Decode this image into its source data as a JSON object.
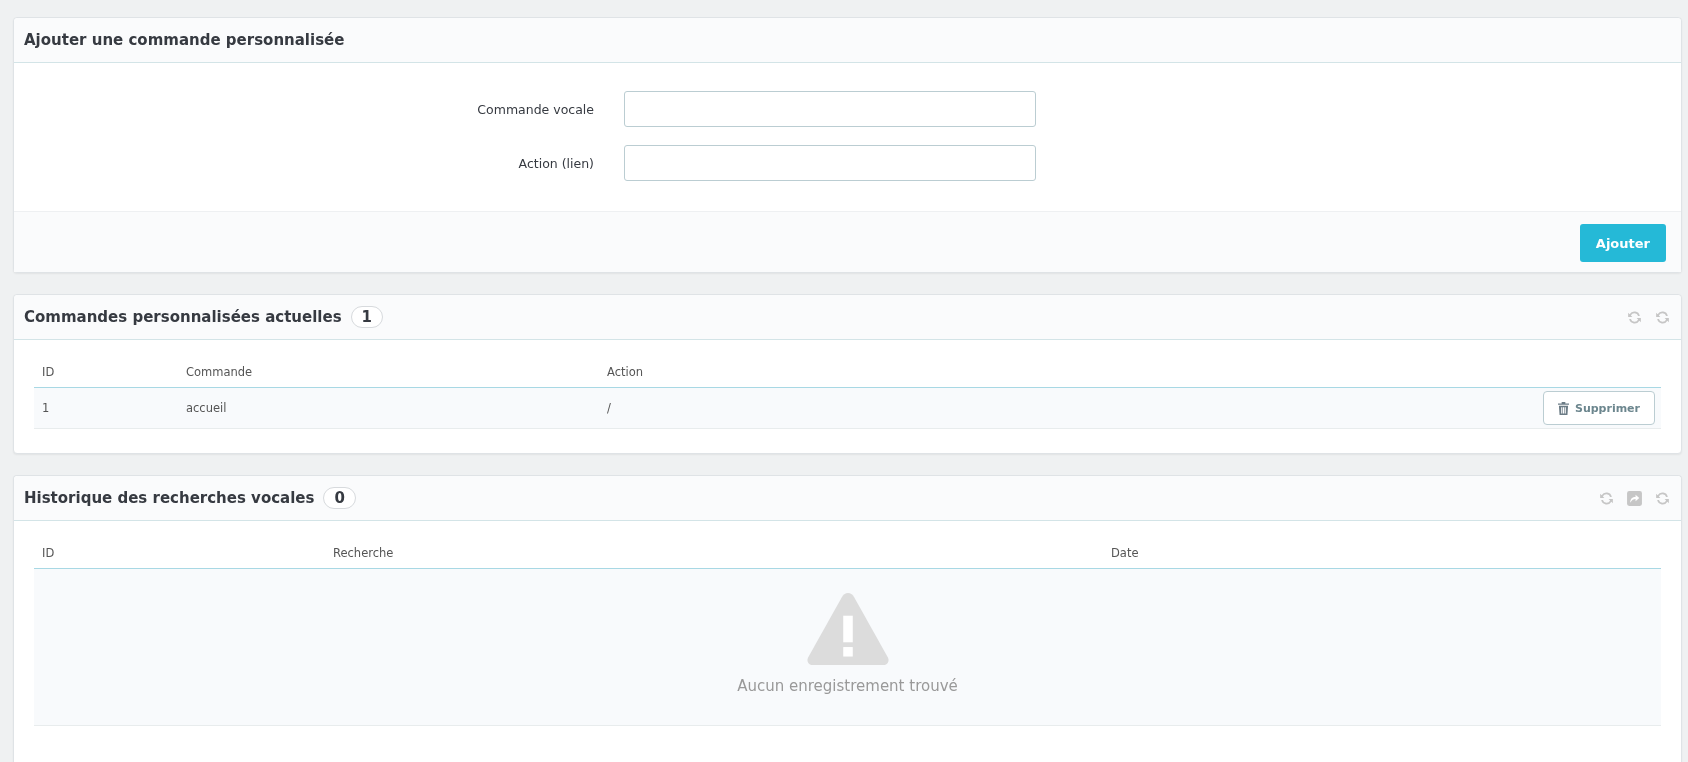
{
  "add_panel": {
    "title": "Ajouter une commande personnalisée",
    "fields": [
      {
        "label": "Commande vocale"
      },
      {
        "label": "Action (lien)"
      }
    ],
    "submit": "Ajouter"
  },
  "commands_panel": {
    "title": "Commandes personnalisées actuelles",
    "count": "1",
    "tools": [
      {
        "kind": "refresh"
      },
      {
        "kind": "refresh"
      }
    ],
    "columns": [
      "ID",
      "Commande",
      "Action"
    ],
    "rows": [
      {
        "id": "1",
        "command": "accueil",
        "action": "/",
        "delete": "Supprimer"
      }
    ]
  },
  "history_panel": {
    "title": "Historique des recherches vocales",
    "count": "0",
    "tools": [
      {
        "kind": "refresh"
      },
      {
        "kind": "export"
      },
      {
        "kind": "refresh"
      }
    ],
    "columns": [
      "ID",
      "Recherche",
      "Date"
    ],
    "empty": "Aucun enregistrement trouvé"
  }
}
